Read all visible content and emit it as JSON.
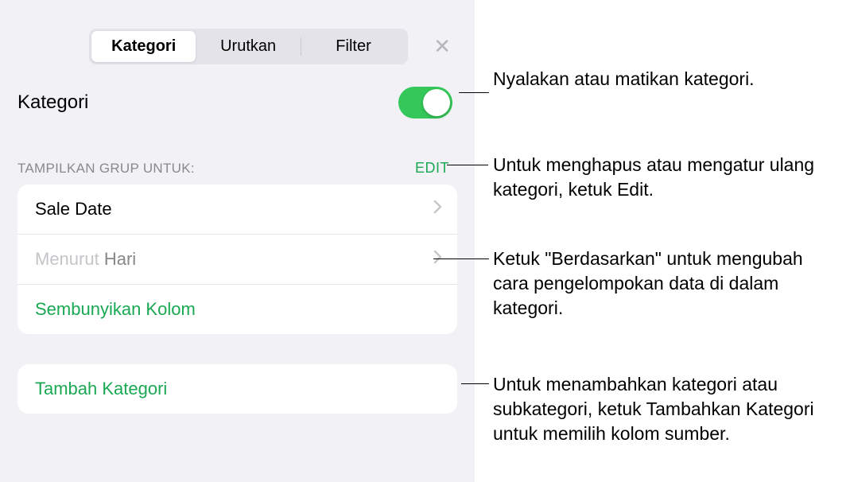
{
  "tabs": {
    "kategori": "Kategori",
    "urutkan": "Urutkan",
    "filter": "Filter"
  },
  "title": "Kategori",
  "section": {
    "label": "TAMPILKAN GRUP UNTUK:",
    "edit": "EDIT"
  },
  "items": {
    "sale_date": "Sale Date",
    "menurut_prefix": "Menurut ",
    "menurut_value": "Hari",
    "sembunyikan": "Sembunyikan Kolom",
    "tambah": "Tambah Kategori"
  },
  "annotations": {
    "toggle": "Nyalakan atau matikan kategori.",
    "edit": "Untuk menghapus atau mengatur ulang kategori, ketuk Edit.",
    "berdasarkan": "Ketuk \"Berdasarkan\" untuk mengubah cara pengelompokan data di dalam kategori.",
    "tambah": "Untuk menambahkan kategori atau subkategori, ketuk Tambahkan Kategori untuk memilih kolom sumber."
  }
}
